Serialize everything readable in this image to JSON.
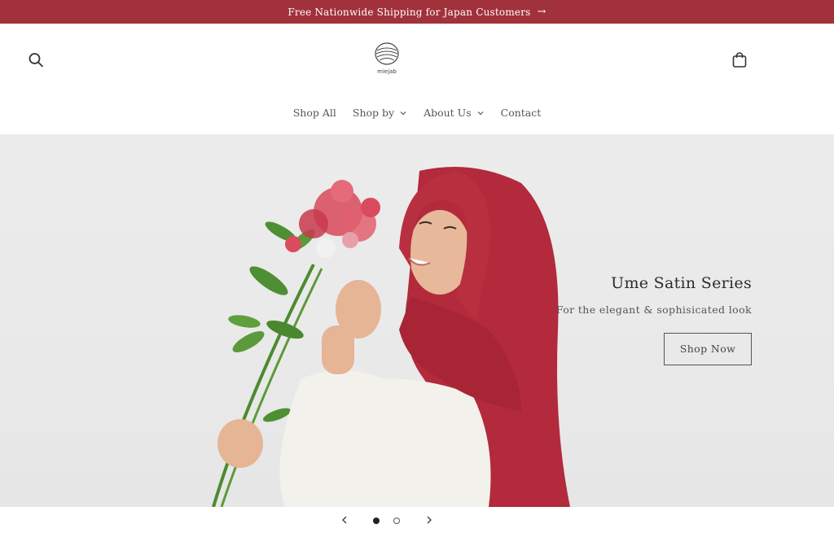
{
  "announcement": {
    "text": "Free Nationwide Shipping for Japan Customers",
    "arrow": "→"
  },
  "header": {
    "logo_text": "miejab",
    "search_icon": "search-icon",
    "cart_icon": "shopping-bag-icon"
  },
  "nav": {
    "items": [
      {
        "label": "Shop All",
        "has_dropdown": false
      },
      {
        "label": "Shop by",
        "has_dropdown": true
      },
      {
        "label": "About Us",
        "has_dropdown": true
      },
      {
        "label": "Contact",
        "has_dropdown": false
      }
    ]
  },
  "hero": {
    "title": "Ume Satin Series",
    "subtitle": "For the elegant & sophisicated look",
    "cta_label": "Shop Now"
  },
  "slider": {
    "slides": 2,
    "active_index": 0
  },
  "colors": {
    "announcement_bg": "#a1313a",
    "hijab_red": "#b32a3a",
    "hero_bg": "#ebebeb"
  }
}
